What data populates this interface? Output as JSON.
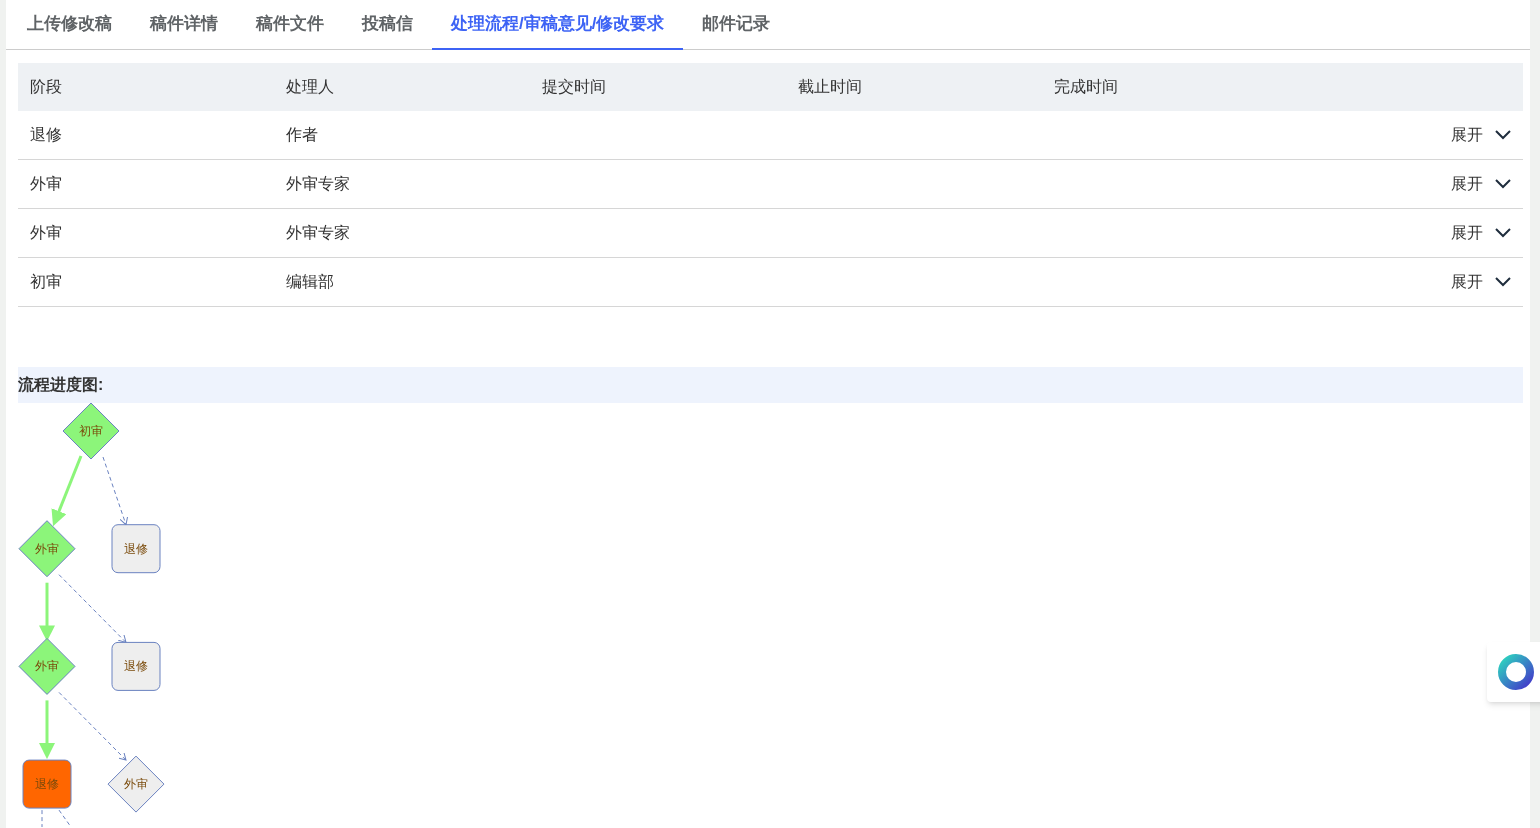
{
  "tabs": [
    {
      "label": "上传修改稿",
      "selected": false
    },
    {
      "label": "稿件详情",
      "selected": false
    },
    {
      "label": "稿件文件",
      "selected": false
    },
    {
      "label": "投稿信",
      "selected": false
    },
    {
      "label": "处理流程/审稿意见/修改要求",
      "selected": true
    },
    {
      "label": "邮件记录",
      "selected": false
    }
  ],
  "table": {
    "columns": [
      "阶段",
      "处理人",
      "提交时间",
      "截止时间",
      "完成时间"
    ],
    "rows": [
      {
        "stage": "退修",
        "handler": "作者",
        "toggle": "展开"
      },
      {
        "stage": "外审",
        "handler": "外审专家",
        "toggle": "展开"
      },
      {
        "stage": "外审",
        "handler": "外审专家",
        "toggle": "展开"
      },
      {
        "stage": "初审",
        "handler": "编辑部",
        "toggle": "展开"
      }
    ]
  },
  "flow": {
    "title": "流程进度图:",
    "levels": [
      {
        "main": {
          "label": "初审",
          "kind": "diamond",
          "color": "#8cf57a"
        }
      },
      {
        "main": {
          "label": "外审",
          "kind": "diamond",
          "color": "#8cf57a"
        },
        "branch": {
          "label": "退修",
          "kind": "box",
          "color": "#eeeeee"
        }
      },
      {
        "main": {
          "label": "外审",
          "kind": "diamond",
          "color": "#8cf57a"
        },
        "branch": {
          "label": "退修",
          "kind": "box",
          "color": "#eeeeee"
        }
      },
      {
        "main": {
          "label": "退修",
          "kind": "box",
          "color": "#ff6600"
        },
        "branch": {
          "label": "外审",
          "kind": "diamond",
          "color": "#eeeeee"
        }
      }
    ]
  }
}
